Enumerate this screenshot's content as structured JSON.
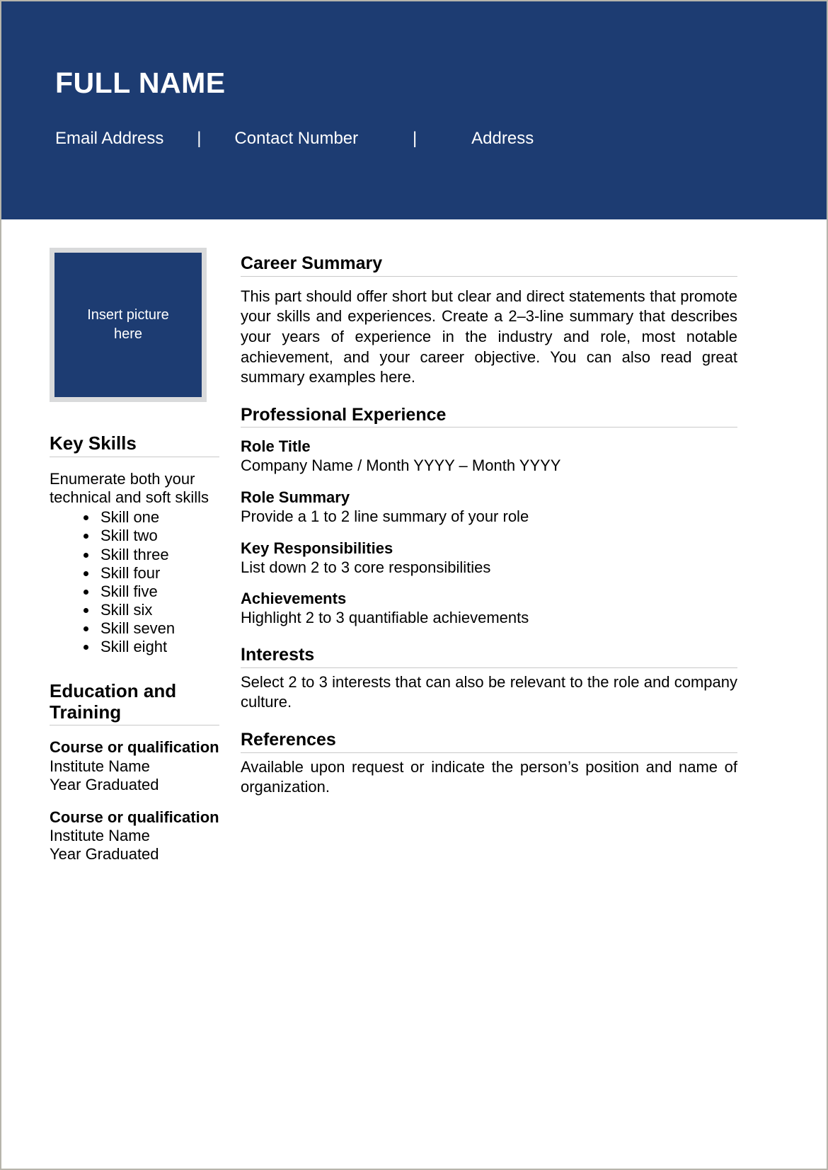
{
  "theme": {
    "navy": "#1d3c72",
    "rule": "#c9c9c9",
    "page_border": "#b7b5ab",
    "photo_frame": "#d9dadb"
  },
  "header": {
    "full_name": "FULL NAME",
    "contact": {
      "email": "Email Address",
      "separator_1": "|",
      "phone": "Contact Number",
      "separator_2": "|",
      "address": "Address"
    }
  },
  "left_column": {
    "photo": {
      "label_line_1": "Insert picture",
      "label_line_2": "here"
    },
    "key_skills": {
      "heading": "Key Skills",
      "intro": "Enumerate both your technical and soft skills",
      "items": [
        "Skill one",
        "Skill two",
        "Skill three",
        "Skill four",
        "Skill five",
        "Skill six",
        "Skill seven",
        "Skill eight"
      ]
    },
    "education": {
      "heading": "Education and Training",
      "entries": [
        {
          "course": "Course or qualifica­tion",
          "institute": "Institute Name",
          "year": "Year Graduated"
        },
        {
          "course": "Course or qualifica­tion",
          "institute": "Institute Name",
          "year": "Year Graduated"
        }
      ]
    }
  },
  "right_column": {
    "career_summary": {
      "heading": "Career Summary",
      "body": "This part should offer short but clear and direct statements that pro­mote your skills and experiences. Create a 2–3-line summary that de­scribes your years of experience in the industry and role, most nota­ble achievement, and your career objective. You can also read great summary examples here."
    },
    "professional_experience": {
      "heading": "Professional Experience",
      "blocks": [
        {
          "title": "Role Title",
          "text": "Company Name / Month YYYY – Month YYYY"
        },
        {
          "title": "Role Summary",
          "text": "Provide a 1 to 2 line summary of your role"
        },
        {
          "title": "Key Responsibilities",
          "text": "List down 2 to 3 core responsibilities"
        },
        {
          "title": "Achievements",
          "text": "Highlight 2 to 3 quantifiable achievements"
        }
      ]
    },
    "interests": {
      "heading": "Interests",
      "body": "Select 2 to 3 interests that can also be relevant to the role and com­pany culture."
    },
    "references": {
      "heading": "References",
      "body": "Available upon request or indicate the person’s position and name of organization."
    }
  }
}
